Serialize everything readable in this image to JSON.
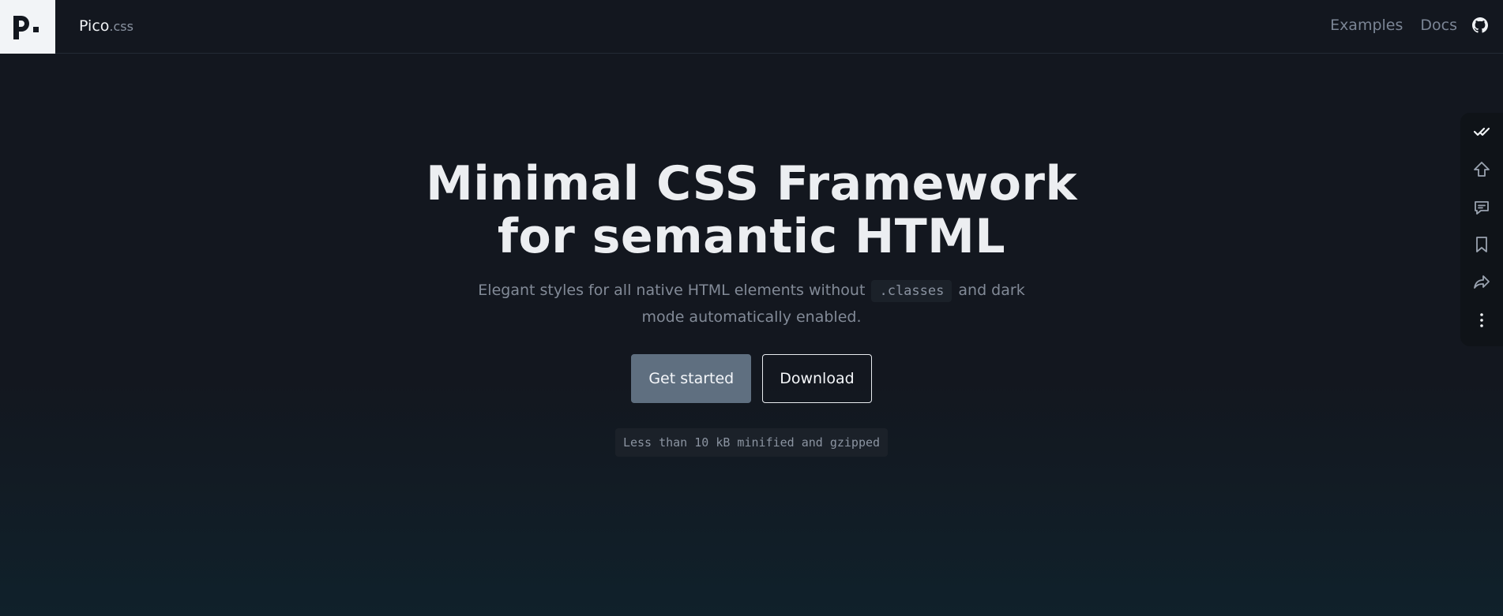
{
  "header": {
    "logo_text": "p.",
    "brand_name": "Pico",
    "brand_suffix": ".css",
    "nav": [
      {
        "label": "Examples"
      },
      {
        "label": "Docs"
      }
    ],
    "github_icon": "github-icon"
  },
  "hero": {
    "title": "Minimal CSS Framework for semantic HTML",
    "subtitle_before": "Elegant styles for all native HTML elements without ",
    "subtitle_code": ".classes",
    "subtitle_after": " and dark mode automatically enabled.",
    "primary_button": "Get started",
    "secondary_button": "Download",
    "size_note": "Less than 10 kB minified and gzipped"
  },
  "toolbar": {
    "icons": [
      "link-check-icon",
      "upload-icon",
      "comment-icon",
      "bookmark-icon",
      "share-icon",
      "more-icon"
    ]
  },
  "colors": {
    "background": "#13171f",
    "primary_button": "#5f6f80",
    "text": "#eceef1",
    "muted": "#828a97"
  }
}
